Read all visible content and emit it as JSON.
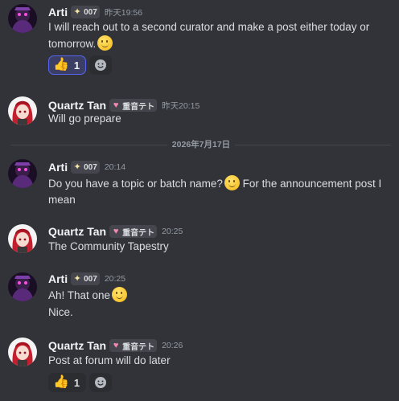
{
  "users": {
    "arti": {
      "name": "Arti",
      "tag": "007",
      "tag_icon": "sparkle-icon",
      "avatar_icon": "purple-character-avatar"
    },
    "quartz": {
      "name": "Quartz Tan",
      "tag": "重音テト",
      "tag_icon": "heart-icon",
      "avatar_icon": "red-hair-character-avatar"
    }
  },
  "divider": {
    "label": "2026年7月17日"
  },
  "messages": [
    {
      "author": "arti",
      "time": "昨天19:56",
      "text": "I will reach out to a second curator and make a post either today or tomorrow.",
      "emoji": "slightly-smiling-face",
      "reactions": [
        {
          "emoji": "thumbs-up",
          "count": "1",
          "active": true
        }
      ]
    },
    {
      "author": "quartz",
      "time": "昨天20:15",
      "text": "Will go prepare"
    },
    {
      "author": "arti",
      "time": "20:14",
      "text_before_emoji": "Do you have a topic or batch name?",
      "emoji": "slightly-smiling-face",
      "text_after_emoji": "For the announcement post I mean"
    },
    {
      "author": "quartz",
      "time": "20:25",
      "text": "The Community Tapestry"
    },
    {
      "author": "arti",
      "time": "20:25",
      "text": "Ah! That one",
      "emoji": "slightly-smiling-face",
      "text_line2": "Nice."
    },
    {
      "author": "quartz",
      "time": "20:26",
      "text": "Post at forum will do later",
      "reactions": [
        {
          "emoji": "thumbs-up",
          "count": "1",
          "active": false
        }
      ]
    }
  ],
  "colors": {
    "background": "#323339",
    "username": "#f2f3f5",
    "message_text": "#dbdee1",
    "timestamp": "#949ba4",
    "reaction_active_border": "#5865f2",
    "reaction_active_bg": "#3b3f66"
  }
}
